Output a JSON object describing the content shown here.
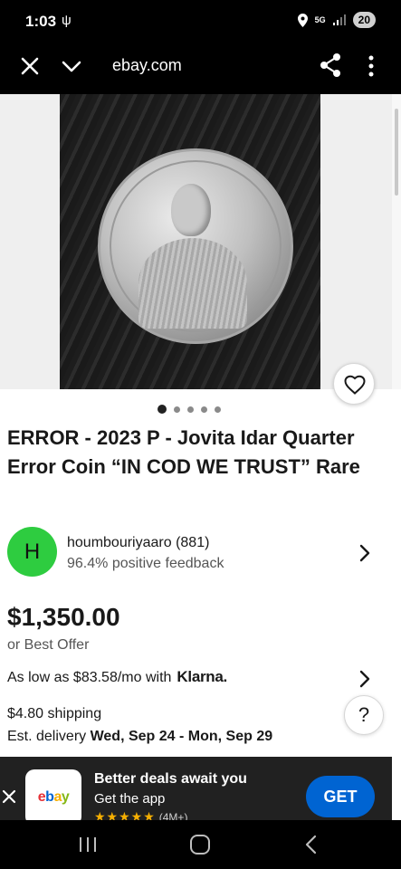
{
  "status_bar": {
    "time": "1:03",
    "network": "5G",
    "battery": "20"
  },
  "browser": {
    "url": "ebay.com"
  },
  "gallery": {
    "image_count": 5,
    "active_index": 0
  },
  "listing": {
    "title": "ERROR - 2023 P - Jovita Idar Quarter Error Coin “IN COD WE TRUST” Rare"
  },
  "seller": {
    "avatar_letter": "H",
    "avatar_color": "#2ecc40",
    "name": "houmbouriyaaro (881)",
    "feedback": "96.4% positive feedback"
  },
  "price": {
    "amount": "$1,350.00",
    "offer": "or Best Offer",
    "financing": "As low as $83.58/mo with",
    "financing_provider": "Klarna."
  },
  "shipping": {
    "cost": "$4.80 shipping",
    "delivery_label": "Est. delivery",
    "delivery_dates": "Wed, Sep 24 - Mon, Sep 29"
  },
  "help": {
    "label": "?"
  },
  "app_banner": {
    "title": "Better deals await you",
    "subtitle": "Get the app",
    "stars": "★★★★★",
    "rating_count": "(4M+)",
    "cta": "GET",
    "logo_letters": [
      "e",
      "b",
      "a",
      "y"
    ],
    "cta_color": "#0064d2"
  },
  "icons": {
    "close": "close-icon",
    "chevron_down": "chevron-down-icon",
    "share": "share-icon",
    "more": "more-vertical-icon",
    "heart": "heart-icon",
    "chevron_right": "chevron-right-icon"
  }
}
